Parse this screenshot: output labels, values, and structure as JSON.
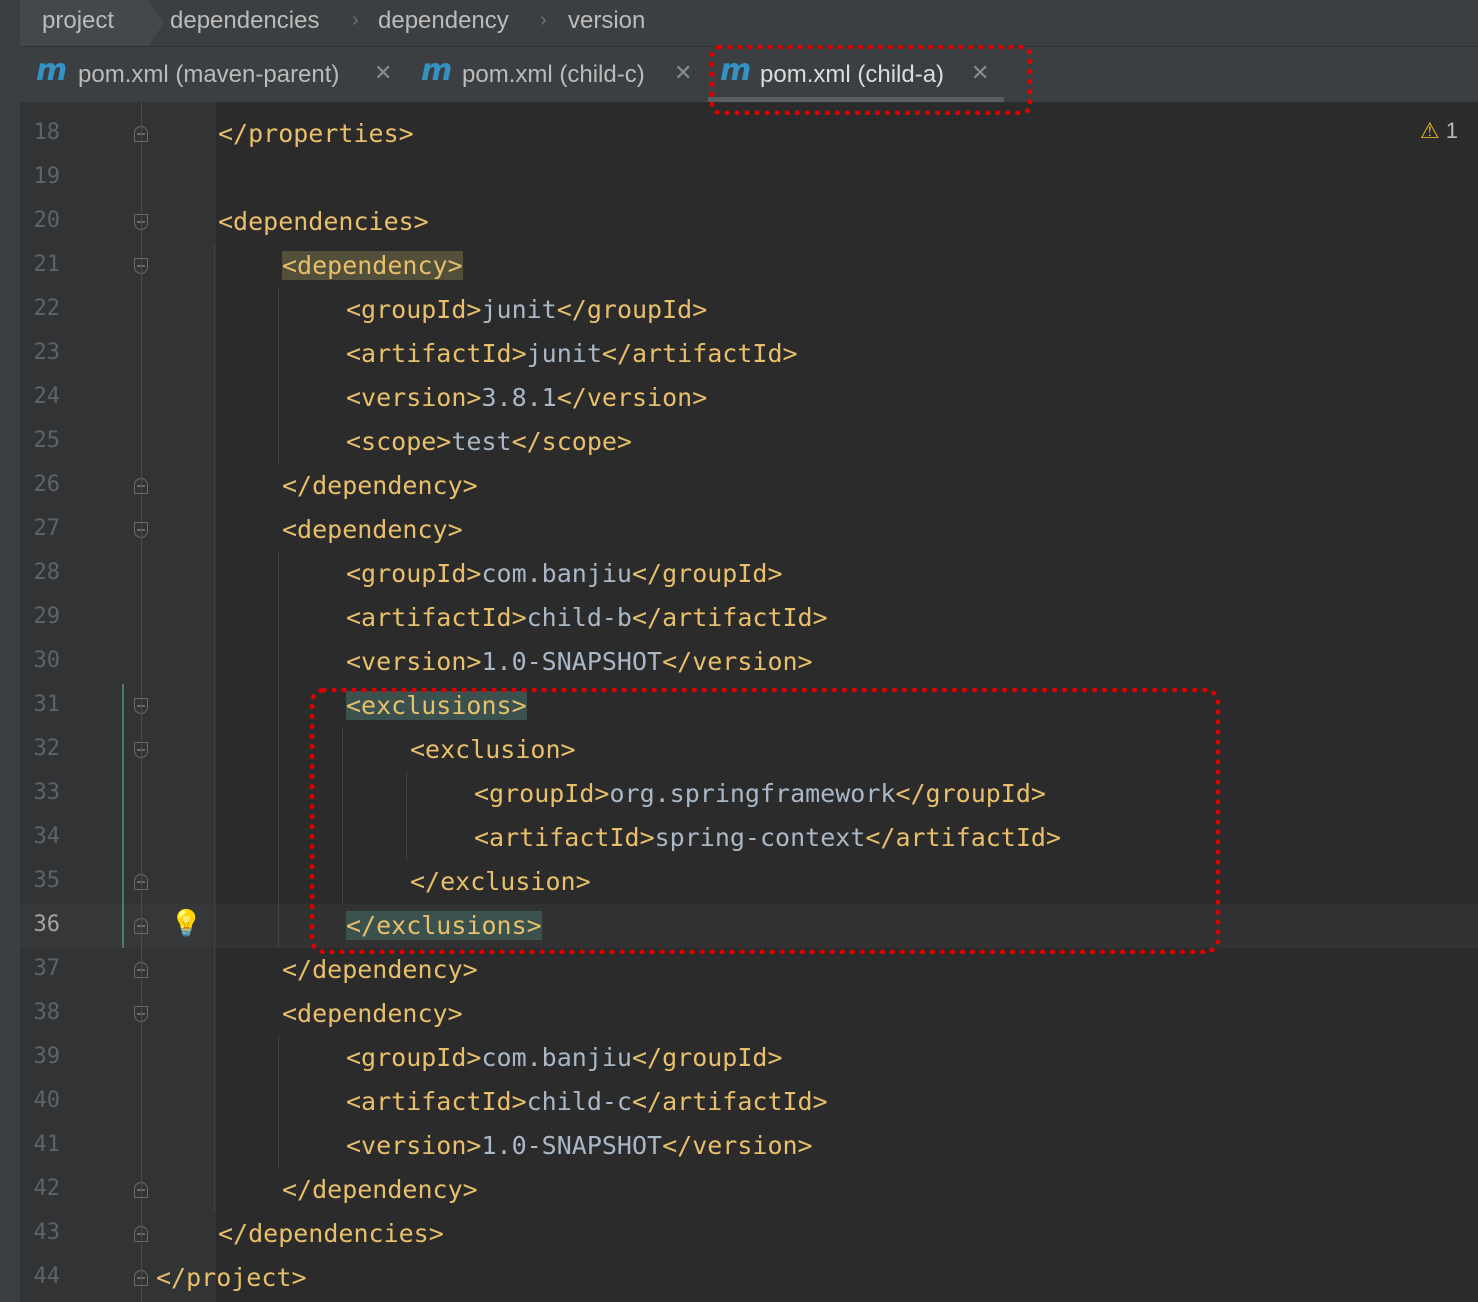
{
  "breadcrumb": [
    "project",
    "dependencies",
    "dependency",
    "version"
  ],
  "tabs": [
    {
      "icon": "m",
      "label": "pom.xml (maven-parent)",
      "close": "✕"
    },
    {
      "icon": "m",
      "label": "pom.xml (child-c)",
      "close": "✕"
    },
    {
      "icon": "m",
      "label": "pom.xml (child-a)",
      "close": "✕",
      "active": true
    }
  ],
  "warning": {
    "icon": "warning-triangle",
    "count": "1"
  },
  "colors": {
    "tag": "#e8bf6a",
    "text": "#a9b7c6",
    "annotation": "#e00000"
  },
  "lines": [
    {
      "n": "18",
      "tag1": "</properties>"
    },
    {
      "n": "19"
    },
    {
      "n": "20",
      "tag1": "<dependencies>"
    },
    {
      "n": "21",
      "tag1": "<dependency>"
    },
    {
      "n": "22",
      "tag1": "<groupId>",
      "text": "junit",
      "tag2": "</groupId>"
    },
    {
      "n": "23",
      "tag1": "<artifactId>",
      "text": "junit",
      "tag2": "</artifactId>"
    },
    {
      "n": "24",
      "tag1": "<version>",
      "text": "3.8.1",
      "tag2": "</version>"
    },
    {
      "n": "25",
      "tag1": "<scope>",
      "text": "test",
      "tag2": "</scope>"
    },
    {
      "n": "26",
      "tag1": "</dependency>"
    },
    {
      "n": "27",
      "tag1": "<dependency>"
    },
    {
      "n": "28",
      "tag1": "<groupId>",
      "text": "com.banjiu",
      "tag2": "</groupId>"
    },
    {
      "n": "29",
      "tag1": "<artifactId>",
      "text": "child-b",
      "tag2": "</artifactId>"
    },
    {
      "n": "30",
      "tag1": "<version>",
      "text": "1.0-SNAPSHOT",
      "tag2": "</version>"
    },
    {
      "n": "31",
      "tag1": "<exclusions>"
    },
    {
      "n": "32",
      "tag1": "<exclusion>"
    },
    {
      "n": "33",
      "tag1": "<groupId>",
      "text": "org.springframework",
      "tag2": "</groupId>"
    },
    {
      "n": "34",
      "tag1": "<artifactId>",
      "text": "spring-context",
      "tag2": "</artifactId>"
    },
    {
      "n": "35",
      "tag1": "</exclusion>"
    },
    {
      "n": "36",
      "tag1": "</exclusions>"
    },
    {
      "n": "37",
      "tag1": "</dependency>"
    },
    {
      "n": "38",
      "tag1": "<dependency>"
    },
    {
      "n": "39",
      "tag1": "<groupId>",
      "text": "com.banjiu",
      "tag2": "</groupId>"
    },
    {
      "n": "40",
      "tag1": "<artifactId>",
      "text": "child-c",
      "tag2": "</artifactId>"
    },
    {
      "n": "41",
      "tag1": "<version>",
      "text": "1.0-SNAPSHOT",
      "tag2": "</version>"
    },
    {
      "n": "42",
      "tag1": "</dependency>"
    },
    {
      "n": "43",
      "tag1": "</dependencies>"
    },
    {
      "n": "44",
      "tag1": "</project>"
    }
  ]
}
